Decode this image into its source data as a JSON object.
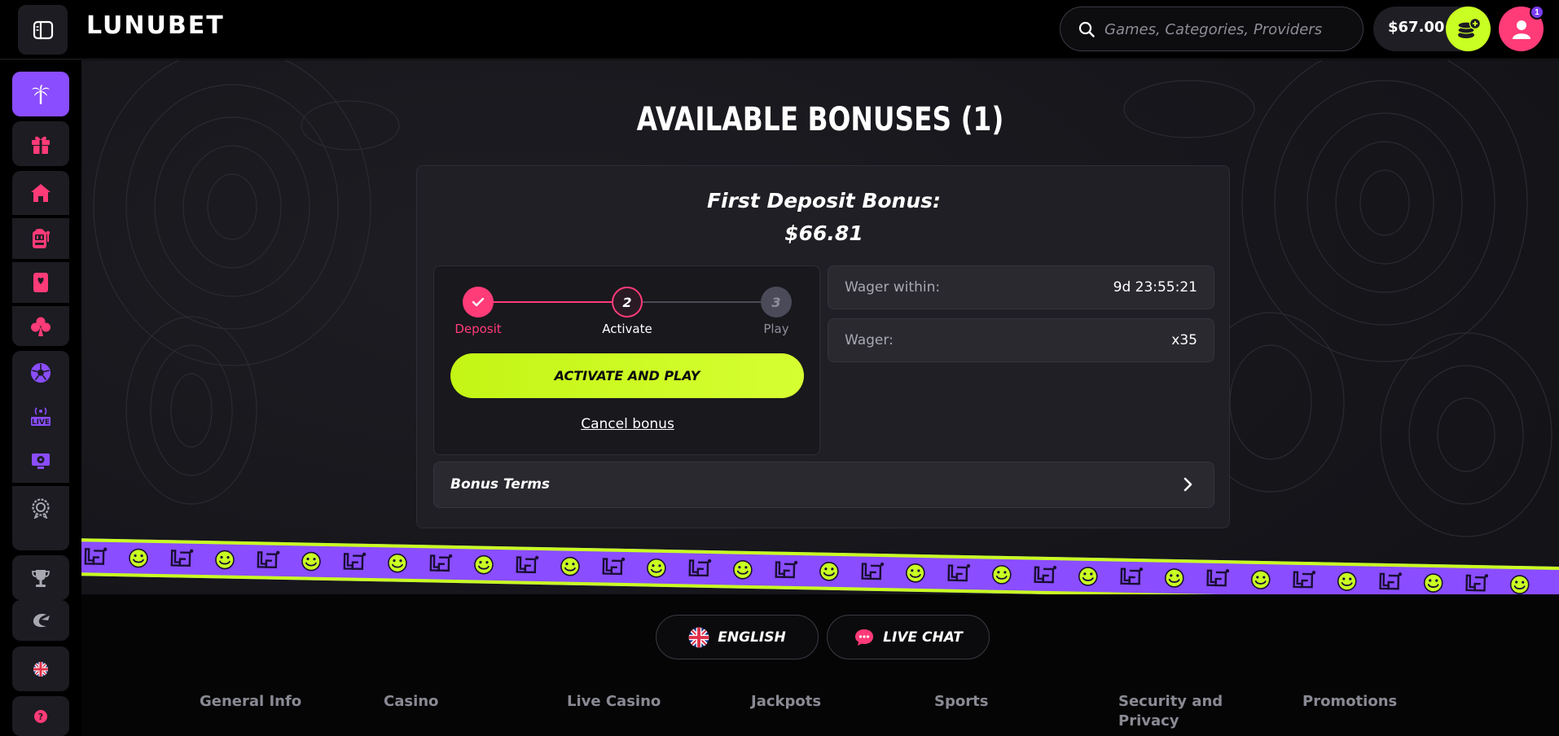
{
  "header": {
    "logo": "LUNUBET",
    "search_placeholder": "Games, Categories, Providers",
    "balance": "$67.00",
    "notification_count": "1"
  },
  "sidebar": {
    "items": [
      {
        "icon": "palm-tree-icon",
        "active": true
      },
      {
        "icon": "gift-icon"
      },
      {
        "icon": "home-icon"
      },
      {
        "icon": "slot-machine-icon"
      },
      {
        "icon": "cards-icon"
      },
      {
        "icon": "club-icon"
      },
      {
        "icon": "soccer-ball-icon"
      },
      {
        "icon": "live-icon"
      },
      {
        "icon": "tv-sport-icon"
      },
      {
        "icon": "badge-icon"
      },
      {
        "icon": "trophy-icon"
      },
      {
        "icon": "moon-icon"
      },
      {
        "icon": "uk-flag-icon"
      },
      {
        "icon": "help-icon"
      }
    ]
  },
  "main": {
    "title": "AVAILABLE BONUSES (1)",
    "bonus": {
      "name": "First Deposit Bonus:",
      "amount": "$66.81",
      "steps": [
        {
          "number": "",
          "label": "Deposit",
          "state": "done"
        },
        {
          "number": "2",
          "label": "Activate",
          "state": "current"
        },
        {
          "number": "3",
          "label": "Play",
          "state": "pending"
        }
      ],
      "activate_label": "ACTIVATE AND PLAY",
      "cancel_label": "Cancel bonus",
      "wager_within_label": "Wager within:",
      "wager_within_value": "9d 23:55:21",
      "wager_label": "Wager:",
      "wager_value": "x35",
      "terms_label": "Bonus Terms"
    }
  },
  "footer": {
    "language_label": "ENGLISH",
    "chat_label": "LIVE CHAT",
    "links": [
      "General Info",
      "Casino",
      "Live Casino",
      "Jackpots",
      "Sports",
      "Security and Privacy",
      "Promotions"
    ]
  },
  "colors": {
    "accent_purple": "#8a4dff",
    "accent_pink": "#ff3b78",
    "accent_lime": "#c9ff22"
  }
}
